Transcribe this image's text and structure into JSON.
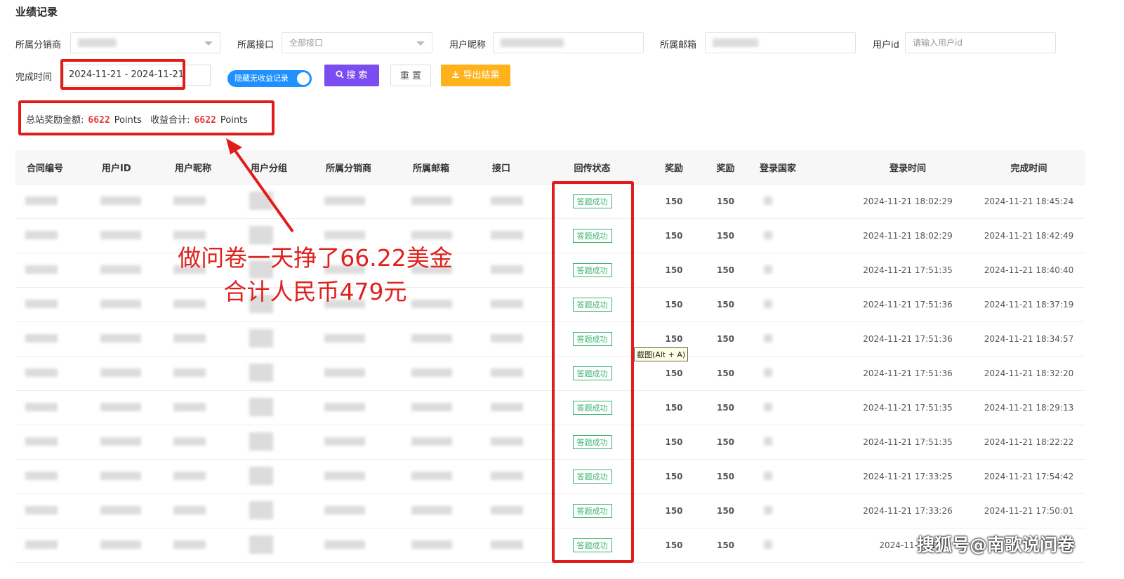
{
  "page": {
    "title": "业绩记录"
  },
  "filters": {
    "distributor_label": "所属分销商",
    "interface_label": "所属接口",
    "interface_value": "全部接口",
    "nickname_label": "用户昵称",
    "email_label": "所属邮箱",
    "userid_label": "用户id",
    "userid_placeholder": "请输入用户id",
    "time_label": "完成时间",
    "date_range": "2024-11-21 - 2024-11-21",
    "toggle_label": "隐藏无收益记录",
    "search_button": "搜 索",
    "reset_button": "重 置",
    "export_button": "导出结果"
  },
  "summary": {
    "total_label": "总站奖励金额:",
    "total_value": "6622",
    "total_unit": "Points",
    "income_label": "收益合计:",
    "income_value": "6622",
    "income_unit": "Points"
  },
  "table": {
    "headers": [
      "合同编号",
      "用户ID",
      "用户昵称",
      "用户分组",
      "所属分销商",
      "所属邮箱",
      "接口",
      "回传状态",
      "奖励",
      "奖励",
      "登录国家",
      "登录时间",
      "完成时间"
    ],
    "rows": [
      {
        "status": "答题成功",
        "reward1": "150",
        "reward2": "150",
        "login": "2024-11-21 18:02:29",
        "done": "2024-11-21 18:45:24"
      },
      {
        "status": "答题成功",
        "reward1": "150",
        "reward2": "150",
        "login": "2024-11-21 18:02:29",
        "done": "2024-11-21 18:42:49"
      },
      {
        "status": "答题成功",
        "reward1": "150",
        "reward2": "150",
        "login": "2024-11-21 17:51:35",
        "done": "2024-11-21 18:40:40"
      },
      {
        "status": "答题成功",
        "reward1": "150",
        "reward2": "150",
        "login": "2024-11-21 17:51:36",
        "done": "2024-11-21 18:37:19"
      },
      {
        "status": "答题成功",
        "reward1": "150",
        "reward2": "150",
        "login": "2024-11-21 17:51:36",
        "done": "2024-11-21 18:34:57"
      },
      {
        "status": "答题成功",
        "reward1": "150",
        "reward2": "150",
        "login": "2024-11-21 17:51:36",
        "done": "2024-11-21 18:32:20"
      },
      {
        "status": "答题成功",
        "reward1": "150",
        "reward2": "150",
        "login": "2024-11-21 17:51:35",
        "done": "2024-11-21 18:29:13"
      },
      {
        "status": "答题成功",
        "reward1": "150",
        "reward2": "150",
        "login": "2024-11-21 17:51:35",
        "done": "2024-11-21 18:22:22"
      },
      {
        "status": "答题成功",
        "reward1": "150",
        "reward2": "150",
        "login": "2024-11-21 17:33:25",
        "done": "2024-11-21 17:54:42"
      },
      {
        "status": "答题成功",
        "reward1": "150",
        "reward2": "150",
        "login": "2024-11-21 17:33:26",
        "done": "2024-11-21 17:50:01"
      },
      {
        "status": "答题成功",
        "reward1": "150",
        "reward2": "150",
        "login": "2024-11-21 1",
        "done": ""
      }
    ]
  },
  "annotation": {
    "line1": "做问卷一天挣了66.22美金",
    "line2": "合计人民币479元"
  },
  "tooltip": "截图(Alt + A)",
  "watermark": "搜狐号@南歌说问卷",
  "colors": {
    "primary": "#7b4cf0",
    "export": "#ffb21a",
    "toggle": "#1e90ff",
    "highlight": "#e21b1b",
    "success": "#3cb371"
  }
}
